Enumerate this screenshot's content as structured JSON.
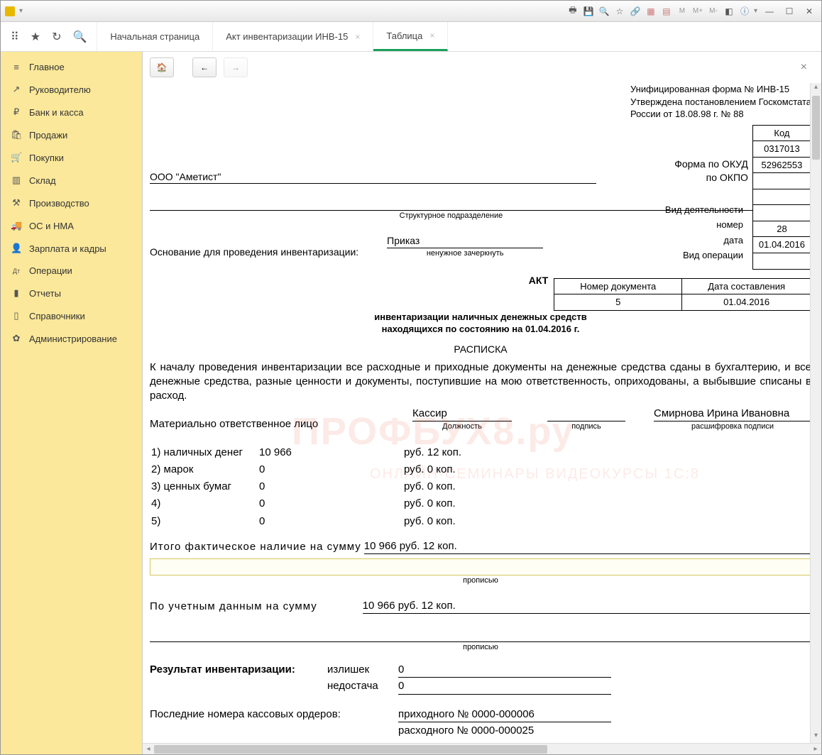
{
  "tabs": {
    "t0": "Начальная страница",
    "t1": "Акт инвентаризации ИНВ-15",
    "t2": "Таблица"
  },
  "sidebar": {
    "items": [
      {
        "icon": "≡",
        "label": "Главное"
      },
      {
        "icon": "↗",
        "label": "Руководителю"
      },
      {
        "icon": "₽",
        "label": "Банк и касса"
      },
      {
        "icon": "🛍",
        "label": "Продажи"
      },
      {
        "icon": "🛒",
        "label": "Покупки"
      },
      {
        "icon": "▥",
        "label": "Склад"
      },
      {
        "icon": "⚒",
        "label": "Производство"
      },
      {
        "icon": "🚚",
        "label": "ОС и НМА"
      },
      {
        "icon": "👤",
        "label": "Зарплата и кадры"
      },
      {
        "icon": "Дт",
        "label": "Операции"
      },
      {
        "icon": "▮",
        "label": "Отчеты"
      },
      {
        "icon": "▯",
        "label": "Справочники"
      },
      {
        "icon": "✿",
        "label": "Администрирование"
      }
    ]
  },
  "doc": {
    "form_line1": "Унифицированная форма №  ИНВ-15",
    "form_line2": "Утверждена постановлением Госкомстата",
    "form_line3": " России от 18.08.98 г. № 88",
    "code_hdr": "Код",
    "okud_lbl": "Форма по ОКУД",
    "okud_val": "0317013",
    "okpo_lbl": "по ОКПО",
    "okpo_val": "52962553",
    "org": "ООО \"Аметист\"",
    "subdiv_caption": "Структурное подразделение",
    "basis_lbl": "Основание для проведения инвентаризации:",
    "basis_val": "Приказ",
    "basis_note": "ненужное зачеркнуть",
    "activity_lbl": "Вид деятельности",
    "number_lbl": "номер",
    "number_val": "28",
    "date_lbl": "дата",
    "date_val": "01.04.2016",
    "optype_lbl": "Вид операции",
    "docnum_hdr": "Номер документа",
    "docdate_hdr": "Дата составления",
    "docnum_val": "5",
    "docdate_val": "01.04.2016",
    "act_title": "АКТ",
    "act_sub1": "инвентаризации наличных денежных средств",
    "act_sub2": "находящихся по состоянию на 01.04.2016 г.",
    "receipt_title": "РАСПИСКА",
    "para": "К началу проведения инвентаризации все расходные и приходные документы на денежные средства сданы в бухгалтерию, и все денежные средства, разные ценности и документы, поступившие на мою ответственность, оприходованы, а выбывшие списаны в расход.",
    "resp_lbl": "Материально ответственное лицо",
    "position_val": "Кассир",
    "position_cap": "Должность",
    "sign_cap": "подпись",
    "name_val": "Смирнова Ирина Ивановна",
    "name_cap": "расшифровка подписи",
    "items": [
      {
        "n": "1) наличных денег",
        "amt": "10 966",
        "rk": "руб. 12 коп."
      },
      {
        "n": "2) марок",
        "amt": "0",
        "rk": "руб. 0 коп."
      },
      {
        "n": "3) ценных бумаг",
        "amt": "0",
        "rk": "руб. 0 коп."
      },
      {
        "n": "4)",
        "amt": "0",
        "rk": "руб. 0 коп."
      },
      {
        "n": "5)",
        "amt": "0",
        "rk": "руб. 0 коп."
      }
    ],
    "total_lbl": "Итого  фактическое  наличие  на  сумму",
    "total_val": "10 966 руб. 12 коп.",
    "in_words_cap": "прописью",
    "book_lbl": "По  учетным  данным  на  сумму",
    "book_val": "10 966 руб. 12 коп.",
    "result_lbl": "Результат инвентаризации:",
    "surplus_lbl": "излишек",
    "surplus_val": "0",
    "short_lbl": "недостача",
    "short_val": "0",
    "orders_lbl": "Последние номера кассовых ордеров:",
    "income_lbl": "приходного № 0000-000006",
    "expense_lbl": "расходного № 0000-000025"
  }
}
